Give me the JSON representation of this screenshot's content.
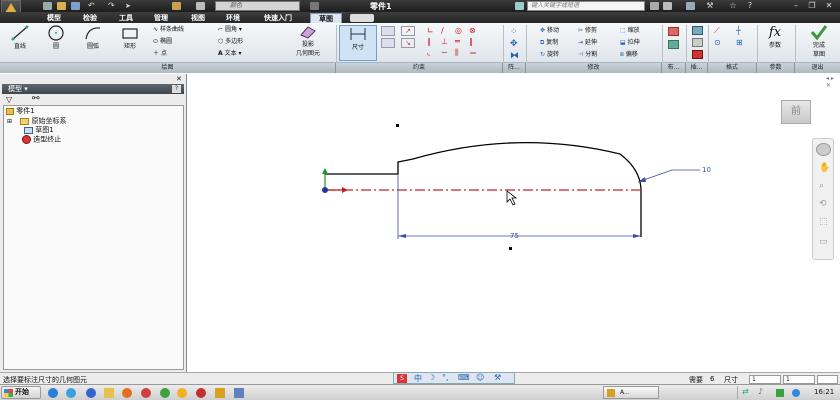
{
  "window": {
    "title": "零件1",
    "pro_badge": "PRO"
  },
  "quick_access": {
    "combo_value": "颜色"
  },
  "search": {
    "placeholder": "键入关键字或短语"
  },
  "tabs": [
    {
      "label": "模型"
    },
    {
      "label": "检验"
    },
    {
      "label": "工具"
    },
    {
      "label": "管理"
    },
    {
      "label": "视图"
    },
    {
      "label": "环境"
    },
    {
      "label": "快速入门"
    },
    {
      "label": "草图",
      "active": true
    }
  ],
  "ribbon": {
    "draw": {
      "line": "直线",
      "circle": "圆",
      "arc": "圆弧",
      "rect": "矩形",
      "spline": "样条曲线",
      "ellipse": "椭圆",
      "point": "点",
      "fillet": "圆角",
      "polygon": "多边形",
      "text": "文本",
      "project_1": "投影",
      "project_2": "几何图元"
    },
    "constrain": {
      "dimension": "尺寸"
    },
    "modify": {
      "move": "移动",
      "trim": "修剪",
      "scale": "缩放",
      "copy": "复制",
      "extend": "延伸",
      "stretch": "拉伸",
      "rotate": "旋转",
      "split": "分割",
      "offset": "偏移"
    },
    "params": {
      "label": "参数"
    },
    "finish": {
      "label_1": "完成",
      "label_2": "草图"
    },
    "groups": [
      "绘图",
      "约束",
      "阵...",
      "修改",
      "布...",
      "插...",
      "格式",
      "参数",
      "退出"
    ]
  },
  "panel": {
    "title": "模型",
    "tree": [
      {
        "label": "零件1"
      },
      {
        "label": "原始坐标系"
      },
      {
        "label": "草图1"
      },
      {
        "label": "造型终止"
      }
    ]
  },
  "canvas": {
    "dim_radius": "10",
    "dim_length": "75",
    "view_cube": "前"
  },
  "status": {
    "prompt": "选择要标注尺寸的几何图元",
    "need_label": "需要",
    "need_value": "6",
    "dim_label": "尺寸",
    "value_1": "1",
    "value_2": "1"
  },
  "taskbar": {
    "start": "开始",
    "task_label": "A...",
    "clock": "16:21"
  },
  "colors": {
    "accent": "#3f7fc6",
    "centerline": "#c0202a",
    "dimension": "#3a4fa0"
  }
}
